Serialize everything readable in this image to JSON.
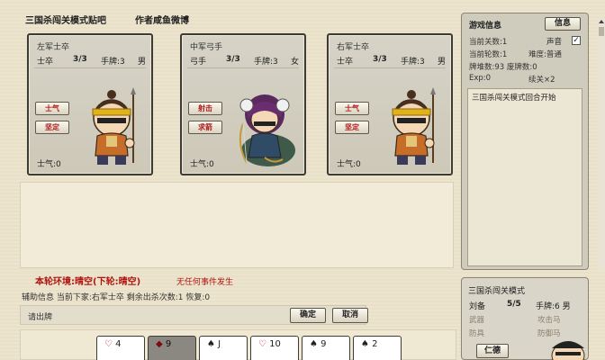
{
  "header": {
    "title": "三国杀闯关模式贴吧",
    "author": "作者咸鱼微博"
  },
  "enemies": [
    {
      "name": "左军士卒",
      "role": "士卒",
      "hp": "3/3",
      "hand": "手牌:3",
      "gender": "男",
      "skills": [
        "士气",
        "坚定"
      ],
      "morale": "士气:0"
    },
    {
      "name": "中军弓手",
      "role": "弓手",
      "hp": "3/3",
      "hand": "手牌:3",
      "gender": "女",
      "skills": [
        "射击",
        "求箭"
      ],
      "morale": "士气:0"
    },
    {
      "name": "右军士卒",
      "role": "士卒",
      "hp": "3/3",
      "hand": "手牌:3",
      "gender": "男",
      "skills": [
        "士气",
        "坚定"
      ],
      "morale": "士气:0"
    }
  ],
  "status": {
    "environment": "本轮环境:晴空(下轮:晴空)",
    "event": "无任何事件发生",
    "aux_info": "辅助信息  当前下家:右军士卒 剩余出杀次数:1 恢复:0",
    "prompt": "请出牌"
  },
  "actions": {
    "confirm": "确定",
    "cancel": "取消"
  },
  "hand_cards": [
    {
      "suit": "♡",
      "rank": "4",
      "color": "red",
      "selected": false
    },
    {
      "suit": "◆",
      "rank": "9",
      "color": "red",
      "selected": true
    },
    {
      "suit": "♠",
      "rank": "J",
      "color": "black",
      "selected": false
    },
    {
      "suit": "♡",
      "rank": "10",
      "color": "red",
      "selected": false
    },
    {
      "suit": "♠",
      "rank": "9",
      "color": "black",
      "selected": false
    },
    {
      "suit": "♠",
      "rank": "2",
      "color": "black",
      "selected": false
    }
  ],
  "game_info": {
    "header": "游戏信息",
    "info_button": "信息",
    "level": "当前关数:1",
    "sound_label": "声音",
    "sound_checked": "✓",
    "round": "当前轮数:1",
    "difficulty": "难度:普通",
    "deck": "牌堆数:93 废牌数:0",
    "exp": "Exp:0",
    "hp_extra": "续关×2",
    "log": "三国杀闯关模式回合开始"
  },
  "player": {
    "title": "三国杀闯关模式",
    "name": "刘备",
    "hp": "5/5",
    "hand": "手牌:6 男",
    "weapon": "武器",
    "attack_horse": "攻击马",
    "armor": "防具",
    "defense_horse": "防御马",
    "skill": "仁德"
  },
  "colors": {
    "background": "#ece4cc",
    "accent_red": "#b0140f",
    "card_border": "#3f3c36"
  }
}
